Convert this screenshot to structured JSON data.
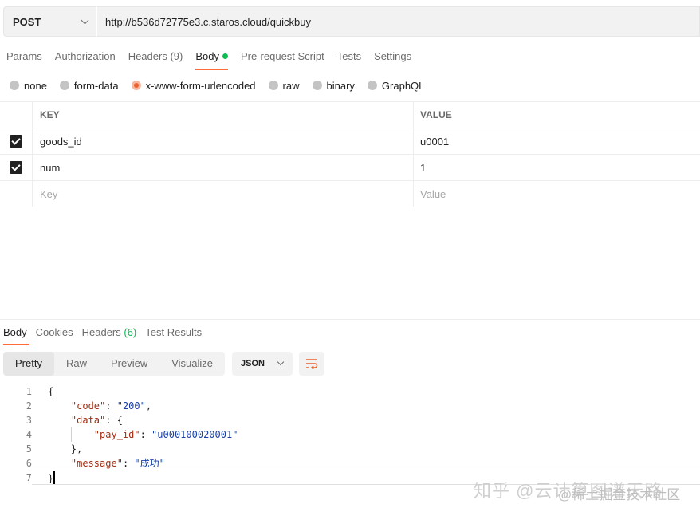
{
  "request": {
    "method": "POST",
    "url": "http://b536d72775e3.c.staros.cloud/quickbuy"
  },
  "request_tabs": [
    {
      "label": "Params"
    },
    {
      "label": "Authorization"
    },
    {
      "label": "Headers",
      "count": "(9)"
    },
    {
      "label": "Body",
      "active": true
    },
    {
      "label": "Pre-request Script"
    },
    {
      "label": "Tests"
    },
    {
      "label": "Settings"
    }
  ],
  "body_types": [
    {
      "label": "none"
    },
    {
      "label": "form-data"
    },
    {
      "label": "x-www-form-urlencoded",
      "selected": true
    },
    {
      "label": "raw"
    },
    {
      "label": "binary"
    },
    {
      "label": "GraphQL"
    }
  ],
  "params_table": {
    "headers": {
      "key": "KEY",
      "value": "VALUE"
    },
    "rows": [
      {
        "key": "goods_id",
        "value": "u0001",
        "checked": true
      },
      {
        "key": "num",
        "value": "1",
        "checked": true
      }
    ],
    "placeholder": {
      "key": "Key",
      "value": "Value"
    }
  },
  "response_tabs": [
    {
      "label": "Body",
      "active": true
    },
    {
      "label": "Cookies"
    },
    {
      "label": "Headers",
      "count": "(6)"
    },
    {
      "label": "Test Results"
    }
  ],
  "view_modes": [
    "Pretty",
    "Raw",
    "Preview",
    "Visualize"
  ],
  "active_view": "Pretty",
  "format": "JSON",
  "response_body": {
    "line_numbers": [
      "1",
      "2",
      "3",
      "4",
      "5",
      "6",
      "7"
    ],
    "open_brace": "{",
    "code_key": "\"code\"",
    "code_value": "\"200\"",
    "data_key": "\"data\"",
    "pay_id_key": "\"pay_id\"",
    "pay_id_value": "\"u000100020001\"",
    "message_key": "\"message\"",
    "message_value": "\"成功\"",
    "close_brace": "}"
  },
  "watermark": {
    "line1": "知乎 @云计算图谱天路",
    "line2": "@稀土掘金技术社区"
  },
  "colors": {
    "accent": "#ff6c37",
    "status_green": "#0cbb52"
  },
  "icons": {
    "method_dropdown": "chevron-down-icon",
    "format_dropdown": "chevron-down-icon",
    "wrap": "wrap-lines-icon",
    "checkbox": "check-icon"
  }
}
